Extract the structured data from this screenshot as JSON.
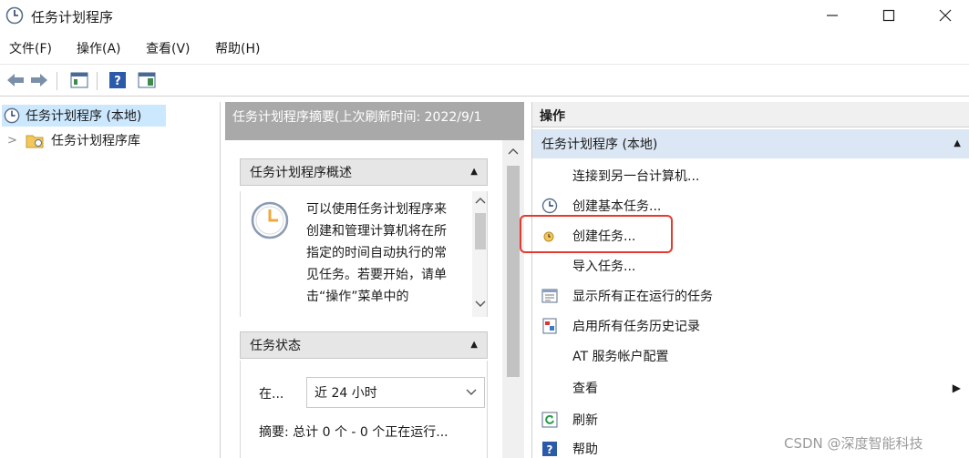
{
  "window": {
    "title": "任务计划程序"
  },
  "menu": {
    "items": [
      "文件(F)",
      "操作(A)",
      "查看(V)",
      "帮助(H)"
    ]
  },
  "tree": {
    "root": "任务计划程序 (本地)",
    "child": "任务计划程序库",
    "expander": ">"
  },
  "summary": {
    "header": "任务计划程序摘要(上次刷新时间: 2022/9/1",
    "overview_title": "任务计划程序概述",
    "overview_text": "可以使用任务计划程序来创建和管理计算机将在所指定的时间自动执行的常见任务。若要开始，请单击“操作”菜单中的",
    "status_title": "任务状态",
    "status_in_label": "在...",
    "status_period": "近 24 小时",
    "status_summary": "摘要: 总计 0 个 - 0 个正在运行..."
  },
  "actions": {
    "title": "操作",
    "group": "任务计划程序 (本地)",
    "items": [
      {
        "label": "连接到另一台计算机...",
        "icon": "none"
      },
      {
        "label": "创建基本任务...",
        "icon": "clock-icon"
      },
      {
        "label": "创建任务...",
        "icon": "task-icon"
      },
      {
        "label": "导入任务...",
        "icon": "none"
      },
      {
        "label": "显示所有正在运行的任务",
        "icon": "running-tasks-icon"
      },
      {
        "label": "启用所有任务历史记录",
        "icon": "history-icon"
      },
      {
        "label": "AT 服务帐户配置",
        "icon": "none"
      },
      {
        "label": "查看",
        "icon": "none",
        "submenu": "▶"
      },
      {
        "label": "刷新",
        "icon": "refresh-icon"
      },
      {
        "label": "帮助",
        "icon": "help-icon"
      }
    ]
  },
  "watermark": "CSDN @深度智能科技",
  "colors": {
    "highlight": "#e53b2f",
    "selection": "#cce8ff",
    "group_header": "#dbe7f4"
  }
}
